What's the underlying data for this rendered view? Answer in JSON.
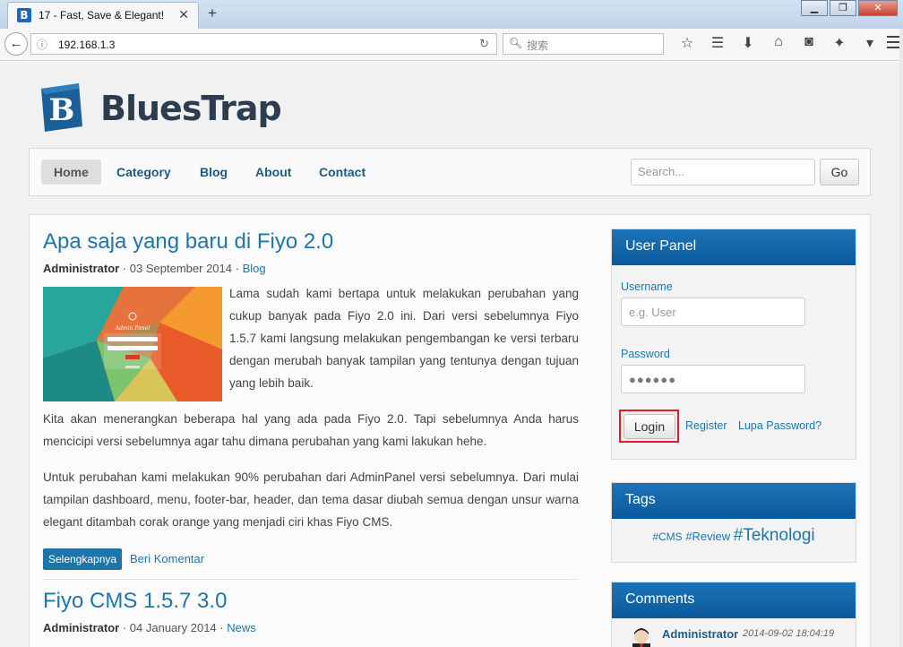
{
  "browser": {
    "tab_title": "17 - Fast, Save & Elegant!",
    "tab_icon": "B",
    "url": "192.168.1.3",
    "search_placeholder": "搜索",
    "window_buttons": [
      "minimize",
      "restore",
      "close"
    ]
  },
  "site": {
    "logo_text": "BluesTrap",
    "brand_color": "#1e76a8"
  },
  "menu": {
    "items": [
      "Home",
      "Category",
      "Blog",
      "About",
      "Contact"
    ],
    "active": "Home",
    "search_placeholder": "Search...",
    "go_label": "Go"
  },
  "posts": [
    {
      "title": "Apa saja yang baru di Fiyo 2.0",
      "author": "Administrator",
      "date": "03 September 2014",
      "category": "Blog",
      "thumb_caption": "Admin Panel",
      "paragraph_1": "Lama sudah kami bertapa untuk melakukan perubahan yang cukup banyak pada Fiyo 2.0 ini. Dari versi sebelumnya Fiyo 1.5.7 kami langsung melakukan pengembangan ke versi terbaru dengan merubah banyak tampilan yang tentunya dengan tujuan yang lebih baik.",
      "paragraph_2": "Kita akan menerangkan beberapa hal yang ada pada Fiyo 2.0. Tapi sebelumnya Anda harus mencicipi versi sebelumnya agar tahu dimana perubahan yang kami lakukan hehe.",
      "paragraph_3": "Untuk perubahan kami melakukan 90% perubahan dari AdminPanel versi sebelumnya. Dari mulai tampilan dashboard, menu, footer-bar, header, dan tema dasar diubah semua dengan unsur warna elegant ditambah corak orange yang menjadi ciri khas Fiyo CMS.",
      "read_more": "Selengkapnya",
      "comment_link": "Beri Komentar"
    },
    {
      "title": "Fiyo CMS 1.5.7 3.0",
      "author": "Administrator",
      "date": "04 January 2014",
      "category": "News"
    }
  ],
  "meta_sep": " · ",
  "user_panel": {
    "title": "User Panel",
    "username_label": "Username",
    "username_placeholder": "e.g. User",
    "password_label": "Password",
    "password_value": "●●●●●●",
    "login_label": "Login",
    "register_label": "Register",
    "forgot_label": "Lupa Password?"
  },
  "tags": {
    "title": "Tags",
    "items": [
      "#CMS",
      "#Review",
      "#Teknologi"
    ]
  },
  "comments": {
    "title": "Comments",
    "latest_author": "Administrator",
    "latest_date": "2014-09-02 18:04:19"
  }
}
